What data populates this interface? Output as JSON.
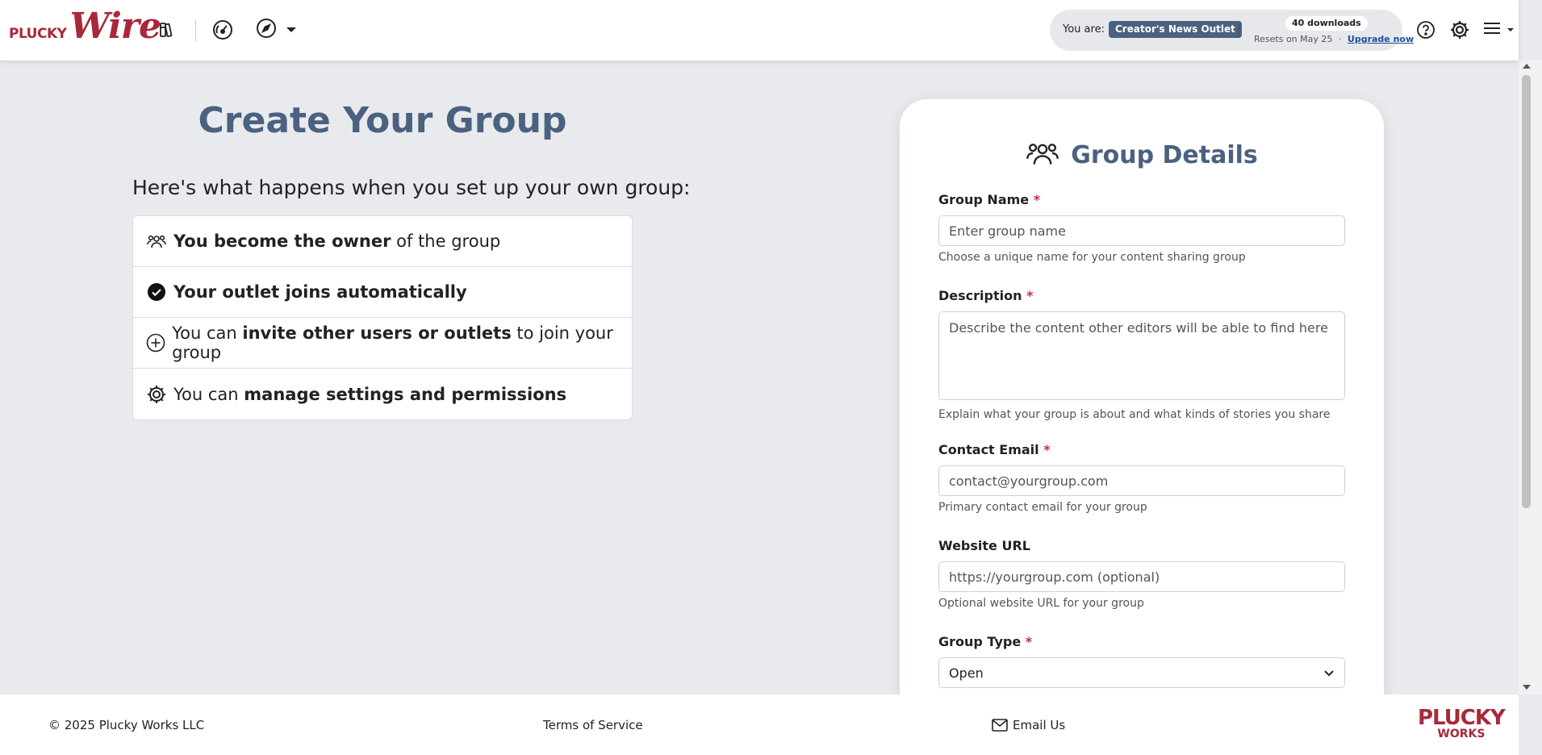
{
  "header": {
    "logo_plucky": "PLUCKY",
    "logo_wire": "Wire",
    "you_are_label": "You are:",
    "outlet_name": "Creator's News Outlet",
    "separator": "|",
    "downloads_badge": "40 downloads",
    "resets_text": "Resets on May 25",
    "resets_dot": "·",
    "upgrade_label": "Upgrade now",
    "icons": [
      "books-icon",
      "dashboard-gauge-icon",
      "compass-icon",
      "help-icon",
      "gear-icon",
      "menu-icon"
    ]
  },
  "main": {
    "title": "Create Your Group",
    "intro": "Here's what happens when you set up your own group:",
    "features": [
      {
        "icon": "people-icon",
        "bold": "You become the owner",
        "rest": " of the group"
      },
      {
        "icon": "check-circle-icon",
        "bold": "Your outlet joins automatically",
        "rest": ""
      },
      {
        "icon": "plus-circle-icon",
        "prefix": "You can ",
        "bold": "invite other users or outlets",
        "rest": " to join your group"
      },
      {
        "icon": "gear-icon",
        "prefix": "You can ",
        "bold": "manage settings and permissions",
        "rest": ""
      }
    ]
  },
  "form": {
    "heading": "Group Details",
    "required_mark": "*",
    "group_name": {
      "label": "Group Name",
      "placeholder": "Enter group name",
      "help": "Choose a unique name for your content sharing group"
    },
    "description": {
      "label": "Description",
      "placeholder": "Describe the content other editors will be able to find here",
      "help": "Explain what your group is about and what kinds of stories you share"
    },
    "contact_email": {
      "label": "Contact Email",
      "placeholder": "contact@yourgroup.com",
      "help": "Primary contact email for your group"
    },
    "website_url": {
      "label": "Website URL",
      "placeholder": "https://yourgroup.com (optional)",
      "help": "Optional website URL for your group"
    },
    "group_type": {
      "label": "Group Type",
      "value": "Open"
    }
  },
  "footer": {
    "copyright": "© 2025 Plucky Works LLC",
    "terms": "Terms of Service",
    "email": "Email Us",
    "logo_line1": "PLUCKY",
    "logo_line2": "WORKS"
  },
  "colors": {
    "brand": "#a8283a",
    "heading": "#4b6180",
    "background": "#e8eaee",
    "required": "#d0273b"
  }
}
